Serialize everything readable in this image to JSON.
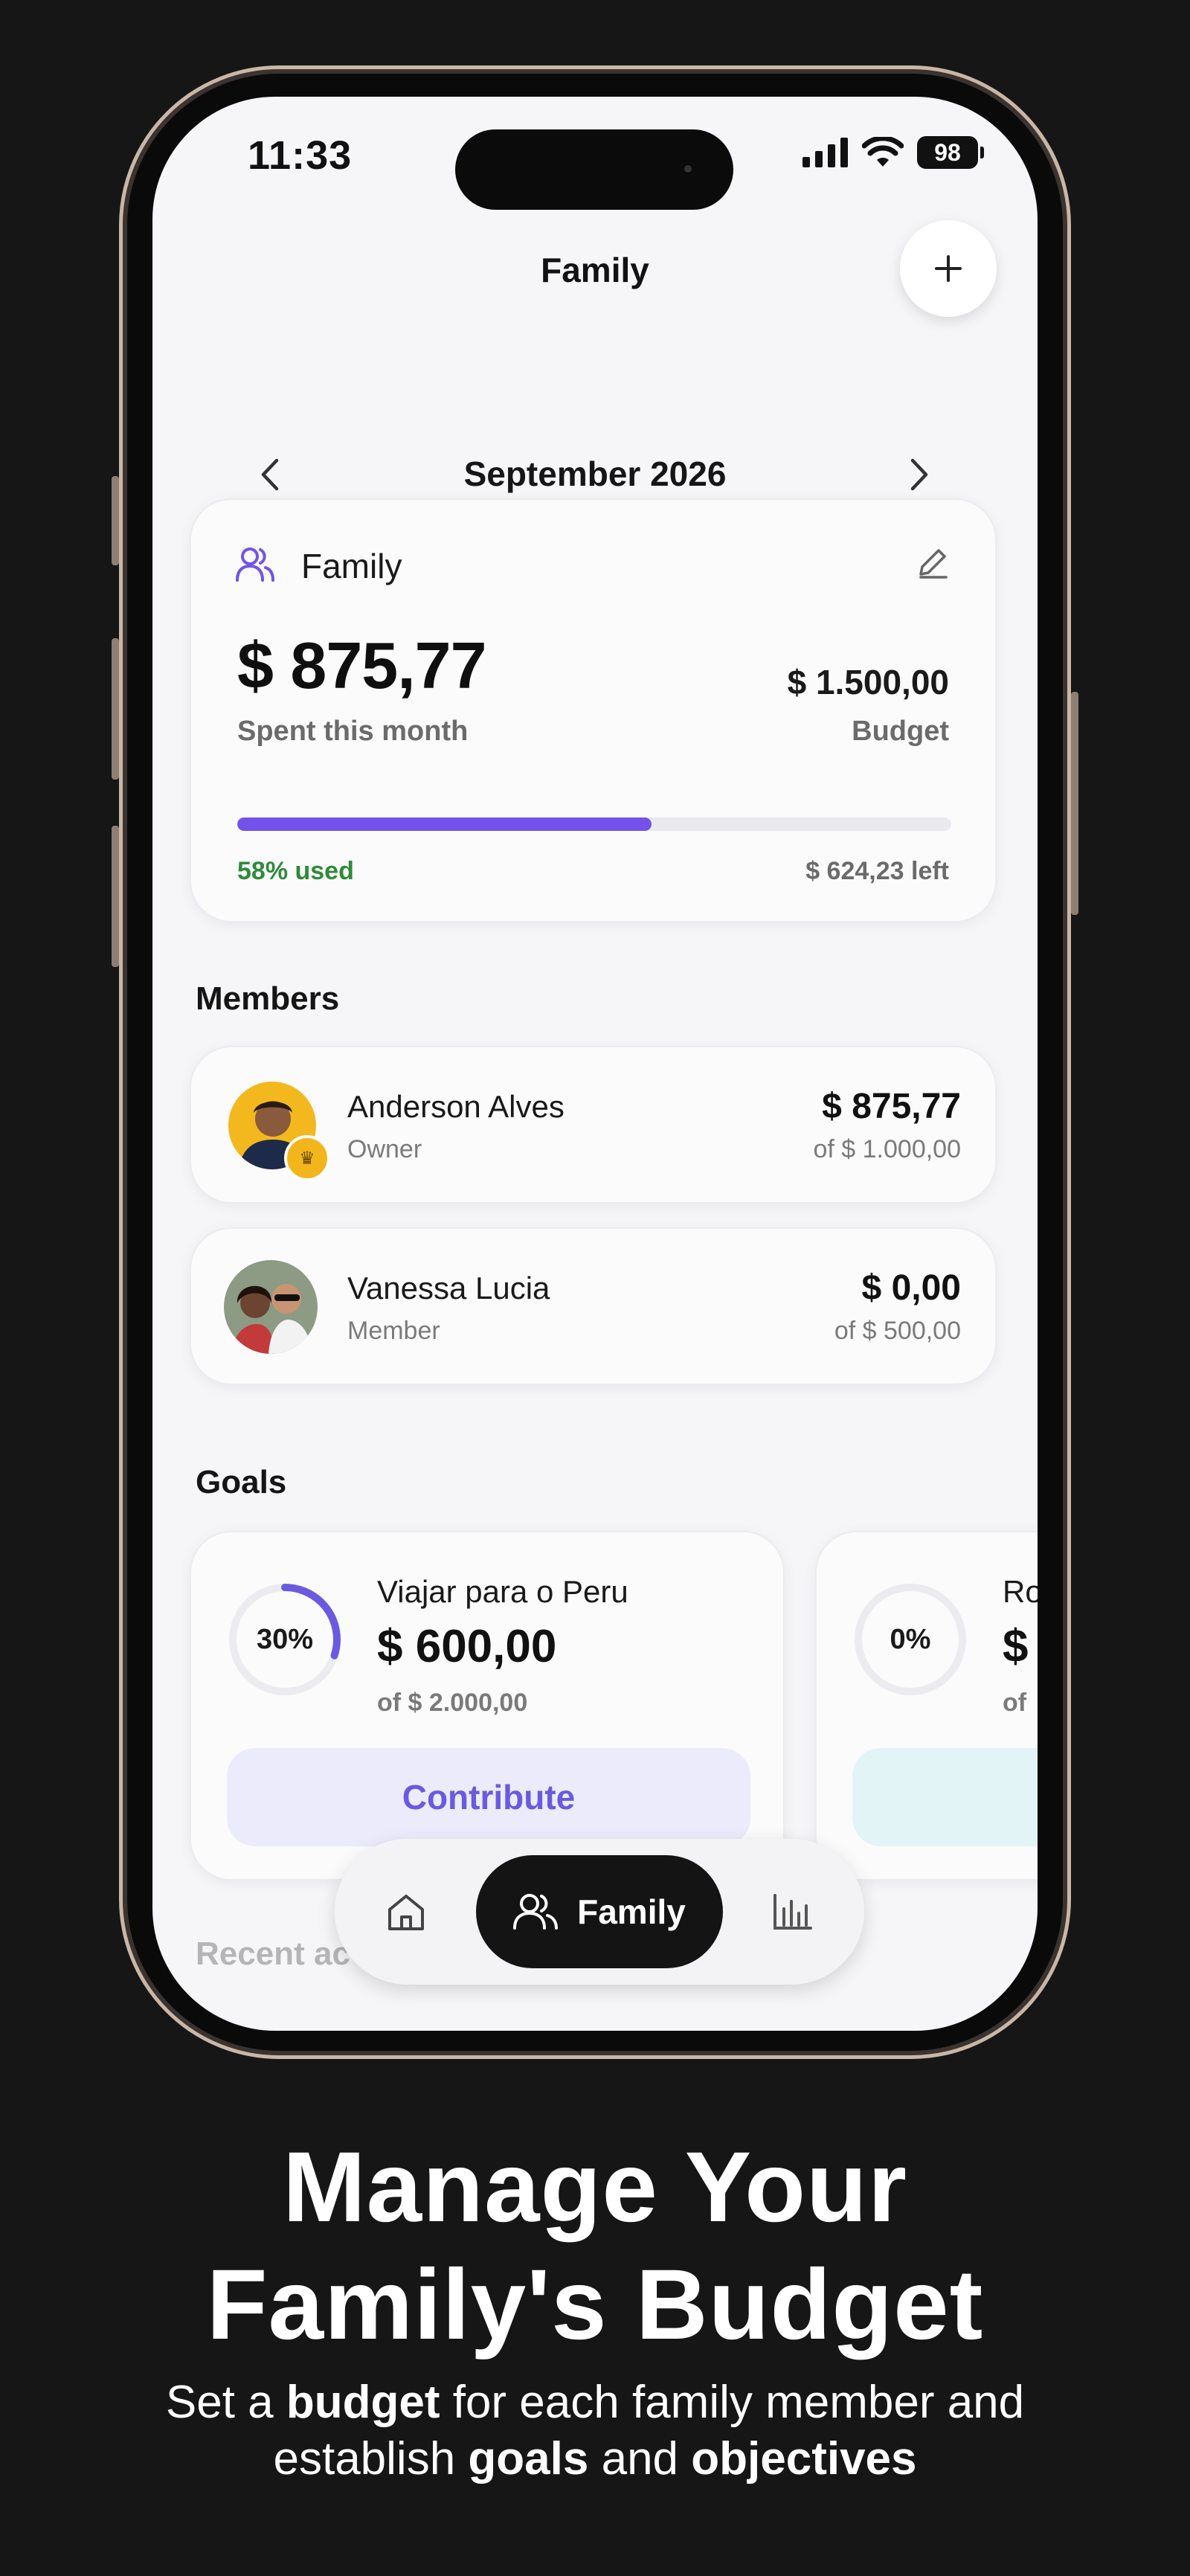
{
  "status_bar": {
    "time": "11:33",
    "battery": "98"
  },
  "header": {
    "title": "Family",
    "add_icon": "plus-icon"
  },
  "month_nav": {
    "label": "September 2026",
    "prev_icon": "chevron-left-icon",
    "next_icon": "chevron-right-icon"
  },
  "summary": {
    "group_name": "Family",
    "spent": "$ 875,77",
    "spent_label": "Spent this month",
    "budget": "$ 1.500,00",
    "budget_label": "Budget",
    "used_fraction": 0.58,
    "used_label": "58% used",
    "left_label": "$ 624,23 left",
    "accent": "#7352ea",
    "used_color": "#2f8a3a"
  },
  "members": {
    "title": "Members",
    "items": [
      {
        "name": "Anderson Alves",
        "role": "Owner",
        "amount": "$ 875,77",
        "of": "of $ 1.000,00"
      },
      {
        "name": "Vanessa Lucia",
        "role": "Member",
        "amount": "$ 0,00",
        "of": "of $ 500,00"
      }
    ]
  },
  "goals": {
    "title": "Goals",
    "items": [
      {
        "name": "Viajar para o Peru",
        "percent": "30%",
        "progress": 0.3,
        "amount": "$ 600,00",
        "of": "of $ 2.000,00",
        "button": "Contribute"
      },
      {
        "name": "Ro",
        "percent": "0%",
        "progress": 0,
        "amount": "$",
        "of": "of"
      }
    ]
  },
  "recent": {
    "title": "Recent ac"
  },
  "tabbar": {
    "active_label": "Family",
    "home_icon": "home-icon",
    "stats_icon": "bar-chart-icon"
  },
  "promo": {
    "headline_line1": "Manage Your",
    "headline_line2": "Family's Budget",
    "sub_1": "Set a ",
    "sub_budget": "budget",
    "sub_2": " for each family member and",
    "sub_3": "establish ",
    "sub_goals": "goals",
    "sub_4": " and ",
    "sub_objectives": "objectives"
  }
}
